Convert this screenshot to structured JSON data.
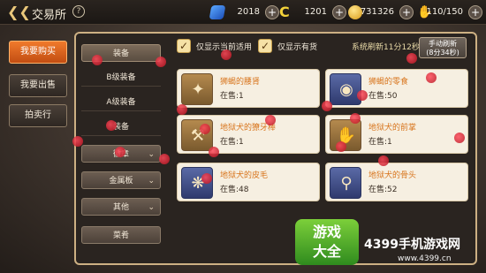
{
  "header": {
    "title": "交易所",
    "help_icon": "help-icon",
    "back_icon": "back-arrow-icon"
  },
  "resources": [
    {
      "name": "diamond",
      "icon": "diamond-icon",
      "value": "2018"
    },
    {
      "name": "currency-c",
      "icon": "c-coin-icon",
      "value": "1201"
    },
    {
      "name": "gold",
      "icon": "gold-coin-icon",
      "value": "731326"
    },
    {
      "name": "stamina",
      "icon": "stamina-icon",
      "value": "110/150"
    }
  ],
  "side_tabs": [
    {
      "label": "我要购买",
      "active": true
    },
    {
      "label": "我要出售",
      "active": false
    },
    {
      "label": "拍卖行",
      "active": false
    }
  ],
  "categories": [
    {
      "label": "装备",
      "type": "selected"
    },
    {
      "label": "B级装备",
      "type": "plain"
    },
    {
      "label": "A级装备",
      "type": "plain"
    },
    {
      "label": "装备",
      "type": "plain"
    },
    {
      "label": "徽章",
      "type": "dropdown"
    },
    {
      "label": "金属板",
      "type": "dropdown"
    },
    {
      "label": "其他",
      "type": "dropdown"
    },
    {
      "label": "菜肴",
      "type": "button"
    }
  ],
  "filters": {
    "only_usable_label": "仅显示当前适用",
    "only_in_stock_label": "仅显示有货",
    "check_mark": "✓"
  },
  "refresh": {
    "info": "系统刷新11分12秒",
    "button_line1": "手动刷新",
    "button_line2": "(8分34秒)"
  },
  "items": [
    {
      "name": "狮蝎的腰肾",
      "stock": "在售:1",
      "icon": "scorpion-kidney-icon",
      "thumb": "gold"
    },
    {
      "name": "狮蝎的零食",
      "stock": "在售:50",
      "icon": "scorpion-snack-icon",
      "thumb": "blue"
    },
    {
      "name": "地狱犬的獠牙棒",
      "stock": "在售:1",
      "icon": "fang-club-icon",
      "thumb": "gold"
    },
    {
      "name": "地狱犬的前掌",
      "stock": "在售:1",
      "icon": "paw-icon",
      "thumb": "gold"
    },
    {
      "name": "地狱犬的皮毛",
      "stock": "在售:48",
      "icon": "fur-icon",
      "thumb": "blue"
    },
    {
      "name": "地狱犬的骨头",
      "stock": "在售:52",
      "icon": "bone-icon",
      "thumb": "blue"
    }
  ],
  "watermark": {
    "logo_line1": "游戏",
    "logo_line2": "大全",
    "site": "4399手机游戏网",
    "url": "www.4399.cn"
  },
  "colors": {
    "accent_orange": "#e8641e",
    "item_name": "#d8751d",
    "panel_border": "#cdb083"
  }
}
